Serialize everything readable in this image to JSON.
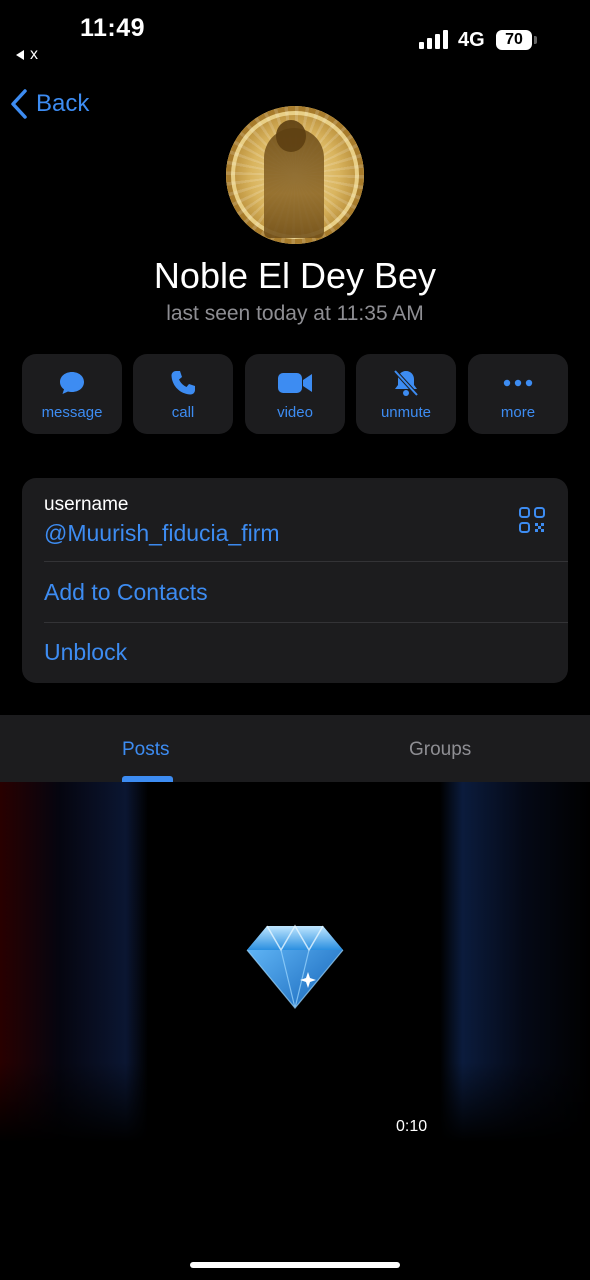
{
  "status_bar": {
    "time": "11:49",
    "back_app": "x",
    "network": "4G",
    "battery": "70"
  },
  "nav": {
    "back_label": "Back"
  },
  "profile": {
    "name": "Noble El Dey Bey",
    "last_seen": "last seen today at 11:35 AM"
  },
  "actions": [
    {
      "label": "message",
      "icon": "chat-bubble-icon"
    },
    {
      "label": "call",
      "icon": "phone-icon"
    },
    {
      "label": "video",
      "icon": "video-camera-icon"
    },
    {
      "label": "unmute",
      "icon": "bell-slash-icon"
    },
    {
      "label": "more",
      "icon": "ellipsis-icon"
    }
  ],
  "info": {
    "username_label": "username",
    "username_value": "@Muurish_fiducia_firm",
    "add_contacts": "Add to Contacts",
    "unblock": "Unblock"
  },
  "tabs": [
    {
      "label": "Posts",
      "active": true
    },
    {
      "label": "Groups",
      "active": false
    }
  ],
  "media": {
    "duration": "0:10",
    "icon": "gem-icon"
  },
  "colors": {
    "accent": "#3d8cf2",
    "card": "#1c1c1e",
    "secondary_text": "#8e8e93"
  }
}
